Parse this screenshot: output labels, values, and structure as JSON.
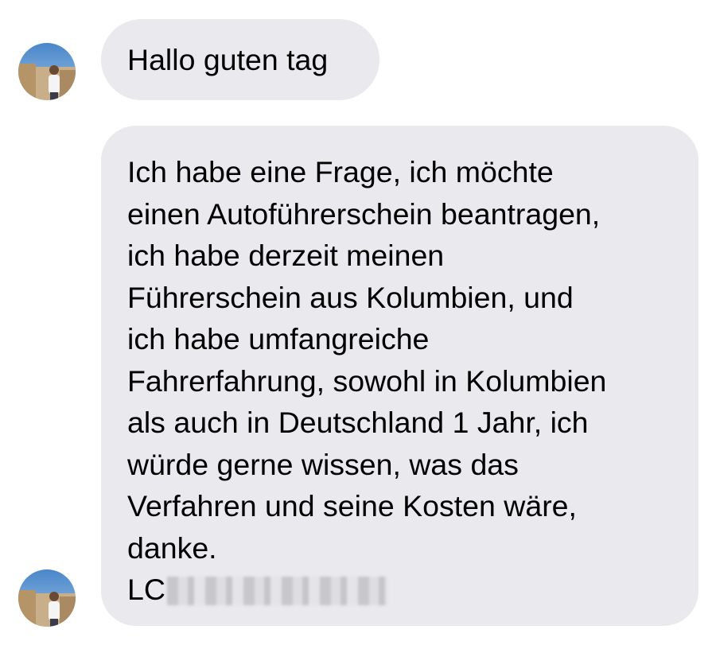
{
  "messages": [
    {
      "text": "Hallo guten tag"
    },
    {
      "text": "Ich habe eine Frage, ich möchte\neinen Autoführerschein beantragen,\nich habe derzeit meinen\nFührerschein aus Kolumbien, und\nich habe umfangreiche\nFahrerfahrung, sowohl in Kolumbien\nals auch in Deutschland 1 Jahr, ich\nwürde gerne wissen, was das\nVerfahren und seine Kosten wäre,\ndanke.",
      "signature_prefix": "LC"
    }
  ],
  "colors": {
    "bubble_background": "#e9e9ee",
    "text": "#000000",
    "page_background": "#ffffff"
  }
}
